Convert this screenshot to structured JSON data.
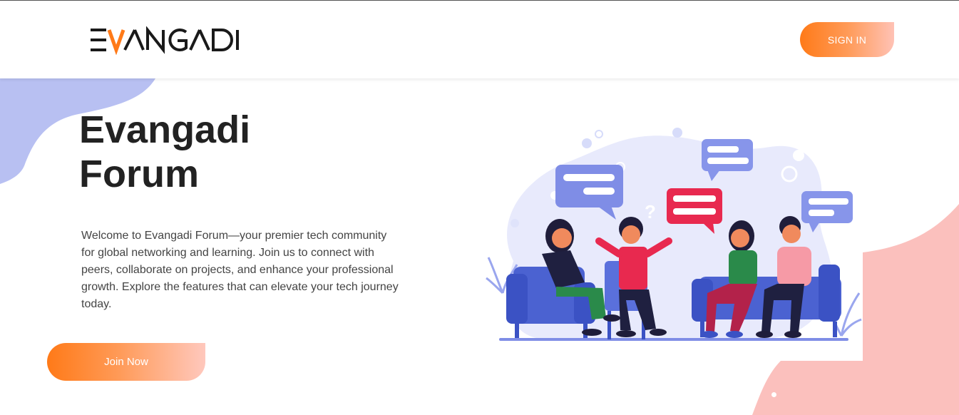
{
  "header": {
    "logo_text": "EVANGADI",
    "signin_label": "SIGN IN"
  },
  "hero": {
    "title": "Evangadi Forum",
    "description": "Welcome to Evangadi Forum—your premier tech community for global networking and learning. Join us to connect with peers, collaborate on projects, and enhance your professional growth. Explore the features that can elevate your tech journey today.",
    "join_label": "Join Now"
  },
  "colors": {
    "accent_orange": "#ff7a18",
    "accent_peach": "#ffc2b5",
    "blob_blue": "#b8c0f2",
    "blob_pink": "#fbc0bd"
  },
  "illustration": {
    "icon": "people-chatting-illustration"
  }
}
